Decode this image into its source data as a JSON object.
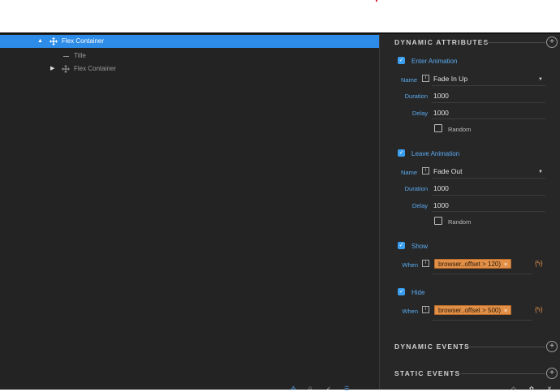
{
  "tree": {
    "items": [
      {
        "label": "Flex Container",
        "selected": true
      },
      {
        "label": "Title",
        "selected": false
      },
      {
        "label": "Flex Container",
        "selected": false
      }
    ]
  },
  "panel": {
    "dynamic_attributes": {
      "title": "DYNAMIC ATTRIBUTES",
      "enter_animation": {
        "label": "Enter Animation",
        "checked": true,
        "name_label": "Name",
        "name_value": "Fade In Up",
        "duration_label": "Duration",
        "duration_value": "1000",
        "delay_label": "Delay",
        "delay_value": "1000",
        "random_label": "Random",
        "random_checked": false
      },
      "leave_animation": {
        "label": "Leave Animation",
        "checked": true,
        "name_label": "Name",
        "name_value": "Fade Out",
        "duration_label": "Duration",
        "duration_value": "1000",
        "delay_label": "Delay",
        "delay_value": "1000",
        "random_label": "Random",
        "random_checked": false
      },
      "show": {
        "label": "Show",
        "checked": true,
        "when_label": "When",
        "expression": "browser..offset > 120)"
      },
      "hide": {
        "label": "Hide",
        "checked": true,
        "when_label": "When",
        "expression": "browser..offset > 500)"
      }
    },
    "dynamic_events": {
      "title": "DYNAMIC EVENTS"
    },
    "static_events": {
      "title": "STATIC EVENTS"
    }
  },
  "colors": {
    "selection": "#2d8ce8",
    "accent_blue": "#5aaaf0",
    "tag_orange": "#e29048",
    "background": "#232323"
  },
  "icons": [
    "move-icon",
    "expand-triangle-icon",
    "collapse-triangle-icon",
    "plus-circle-icon",
    "info-icon",
    "dropdown-caret-icon",
    "checkbox-icon",
    "close-icon",
    "bolt-icon"
  ]
}
